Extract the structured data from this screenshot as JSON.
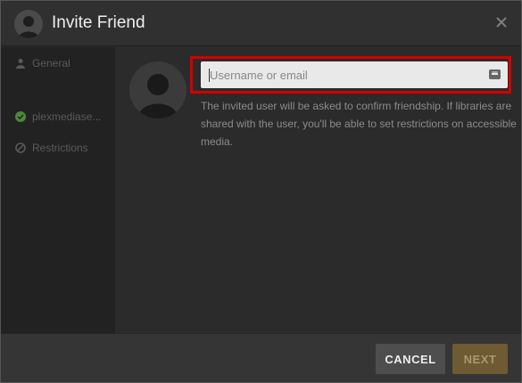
{
  "dialog": {
    "title": "Invite Friend",
    "close_icon": "close-icon"
  },
  "sidebar": {
    "items": [
      {
        "label": "General",
        "icon": "user-icon"
      },
      {
        "label": "plexmediase...",
        "icon": "check-circle-icon"
      },
      {
        "label": "Restrictions",
        "icon": "block-icon"
      }
    ]
  },
  "form": {
    "username_placeholder": "Username or email",
    "username_value": "",
    "helper_text": "The invited user will be asked to confirm friendship. If libraries are shared with the user, you'll be able to set restrictions on accessible media."
  },
  "footer": {
    "cancel_label": "CANCEL",
    "next_label": "NEXT"
  },
  "colors": {
    "highlight_border": "#d40000",
    "next_button": "#6e5a33",
    "check_green": "#4a8a3a"
  }
}
